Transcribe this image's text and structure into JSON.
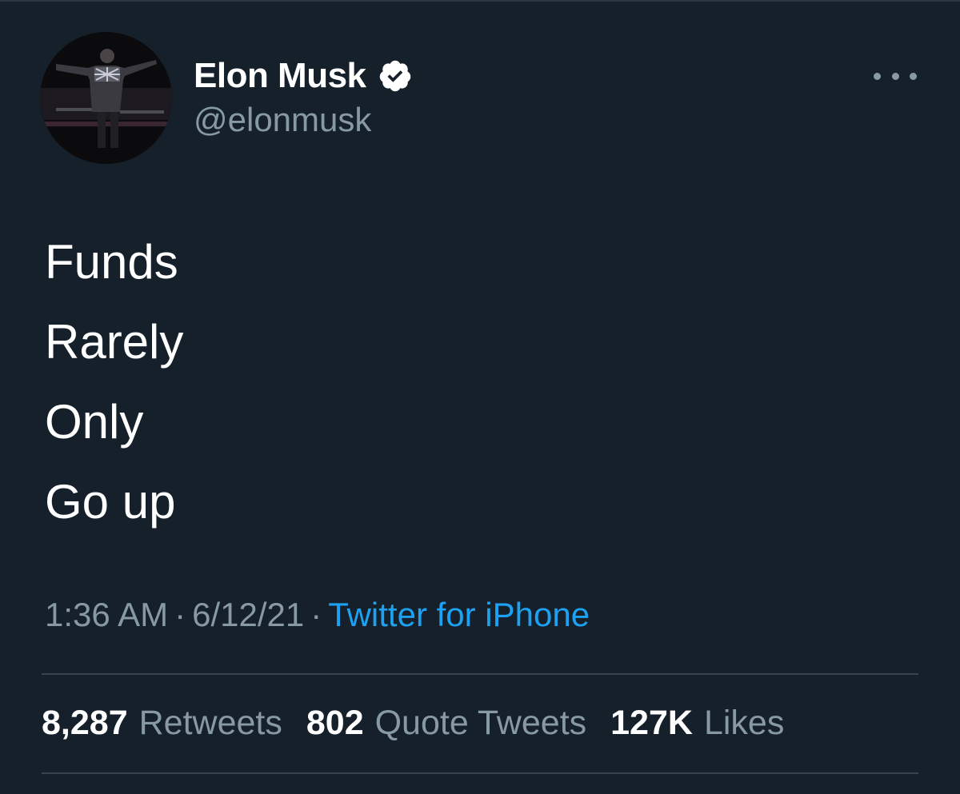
{
  "tweet": {
    "author": {
      "display_name": "Elon Musk",
      "handle": "@elonmusk",
      "verified_icon": "verified-badge-icon"
    },
    "more_icon": "more-options-icon",
    "lines": [
      "Funds",
      "Rarely",
      "Only",
      "Go up"
    ],
    "meta": {
      "time": "1:36 AM",
      "separator": "·",
      "date": "6/12/21",
      "source": "Twitter for iPhone"
    },
    "stats": [
      {
        "count": "8,287",
        "label": "Retweets"
      },
      {
        "count": "802",
        "label": "Quote Tweets"
      },
      {
        "count": "127K",
        "label": "Likes"
      }
    ]
  },
  "colors": {
    "background": "#15202b",
    "primary_text": "#ffffff",
    "secondary_text": "#8899a6",
    "link": "#1da1f2",
    "divider": "#38444d"
  }
}
